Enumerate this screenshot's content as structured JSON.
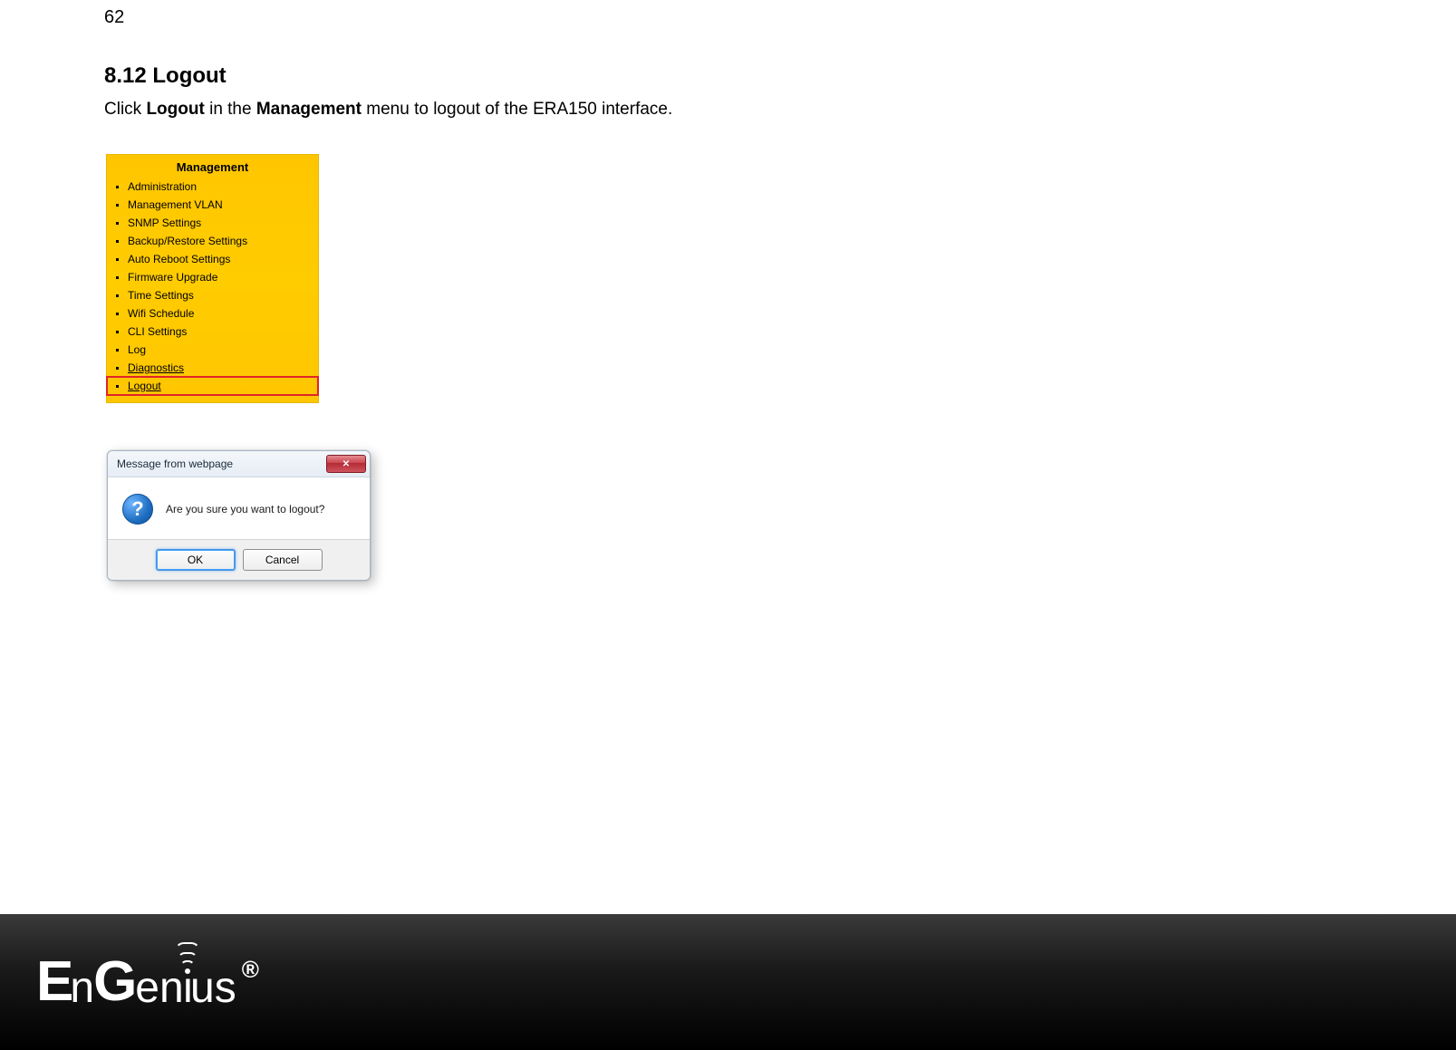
{
  "page_number": "62",
  "section": {
    "heading": "8.12 Logout",
    "intro_pre": "Click ",
    "intro_b1": "Logout",
    "intro_mid": " in the ",
    "intro_b2": "Management",
    "intro_post": " menu to logout of the ERA150 interface."
  },
  "menu": {
    "title": "Management",
    "items": [
      "Administration",
      "Management VLAN",
      "SNMP Settings",
      "Backup/Restore Settings",
      "Auto Reboot Settings",
      "Firmware Upgrade",
      "Time Settings",
      "Wifi Schedule",
      "CLI Settings",
      "Log",
      "Diagnostics",
      "Logout"
    ]
  },
  "dialog": {
    "title": "Message from webpage",
    "message": "Are you sure you want to logout?",
    "ok": "OK",
    "cancel": "Cancel"
  },
  "footer": {
    "brand": "EnGenius",
    "reg": "®"
  }
}
